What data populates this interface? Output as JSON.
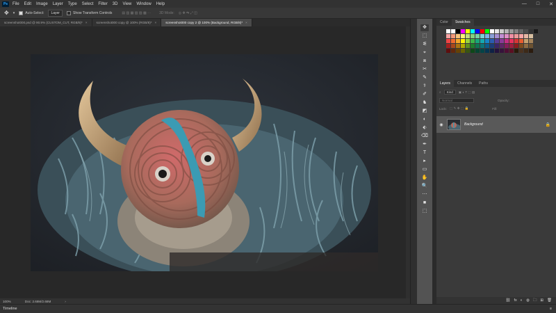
{
  "app": {
    "logo": "Ps"
  },
  "menu": [
    "File",
    "Edit",
    "Image",
    "Layer",
    "Type",
    "Select",
    "Filter",
    "3D",
    "View",
    "Window",
    "Help"
  ],
  "window_controls": [
    "—",
    "□",
    "✕"
  ],
  "options": {
    "auto_select_label": "Auto-Select:",
    "auto_select_value": "Layer",
    "transform_label": "Show Transform Controls",
    "mode_label": "3D Mode:"
  },
  "tabs": [
    {
      "label": "screenshot000.psd @ 90.9% (CUSTOM_CUT, RGB/8)*",
      "close": "×"
    },
    {
      "label": "screenshot000 copy @ 100% (RGB/8)*",
      "close": "×"
    },
    {
      "label": "screenshot000 copy 2 @ 100% (Background, RGB/8)*",
      "close": "×",
      "active": true
    }
  ],
  "status": {
    "zoom": "100%",
    "doc": "Doc: 2.68M/2.68M"
  },
  "timeline": {
    "label": "Timeline"
  },
  "tools": [
    "✥",
    "⬚",
    "ᓬ",
    "⌖",
    "⧈",
    "✂",
    "✎",
    "⚕",
    "✐",
    "♞",
    "◩",
    "◐",
    "⬖",
    "⌫",
    "✒",
    "T",
    "▸",
    "▭",
    "✋",
    "🔍",
    "⋯",
    "■",
    "⬚"
  ],
  "right_panel": {
    "top_tabs": [
      "Color",
      "Swatches"
    ],
    "layers_tabs": [
      "Layers",
      "Channels",
      "Paths"
    ],
    "kind_label": "Kind",
    "blend_mode": "Normal",
    "opacity_label": "Opacity:",
    "lock_label": "Lock:",
    "fill_label": "Fill:",
    "layer_name": "Background",
    "footer_icons": [
      "⛓",
      "fx",
      "◐",
      "◍",
      "🗀",
      "⊞",
      "🗑"
    ]
  },
  "swatch_colors": [
    [
      "#ffffff",
      "#ffffff",
      "#000000",
      "#ff00ff",
      "#ffff00",
      "#00ffff",
      "#0000ff",
      "#ff0000",
      "#00ff00",
      "#ffffff",
      "#e6e6e6",
      "#cccccc",
      "#b3b3b3",
      "#999999",
      "#808080",
      "#666666",
      "#4d4d4d",
      "#333333",
      "#1a1a1a"
    ],
    [
      "#f5a3a3",
      "#f39a7a",
      "#f7c37a",
      "#fff27a",
      "#c3e07a",
      "#84d07e",
      "#7acda3",
      "#79d0d3",
      "#7ab3e5",
      "#8a9fd8",
      "#a68ed3",
      "#c28ed3",
      "#e08fc6",
      "#f08fa3",
      "#ed9a9a",
      "#f7a6a6",
      "#e8b7a5",
      "#d7bfa1"
    ],
    [
      "#ee4444",
      "#ef6b2f",
      "#f4a62a",
      "#fff200",
      "#9ad43b",
      "#3bb54a",
      "#18a67a",
      "#15a9b0",
      "#1585c9",
      "#2a5cb0",
      "#5b3c99",
      "#8b3a97",
      "#c42e83",
      "#e6305c",
      "#d83636",
      "#e65c2f",
      "#c4a070",
      "#a5845a"
    ],
    [
      "#a61e1e",
      "#a8481c",
      "#ad7410",
      "#b3aa00",
      "#62921c",
      "#1d7d2d",
      "#0e7452",
      "#0b7478",
      "#0b5b8a",
      "#1b3c78",
      "#3c2466",
      "#5d2566",
      "#861c5a",
      "#9c1e3e",
      "#8a1c1c",
      "#7c4a1d",
      "#8c6b42",
      "#6c5231"
    ],
    [
      "#5e0e0e",
      "#62270c",
      "#664205",
      "#6a6400",
      "#385512",
      "#0e4818",
      "#064430",
      "#044447",
      "#053551",
      "#0e2246",
      "#23123c",
      "#36133b",
      "#4e0e34",
      "#5b0f22",
      "#2a1a0a",
      "#4a3220",
      "#3d2a18",
      "#2b1c0f"
    ]
  ]
}
